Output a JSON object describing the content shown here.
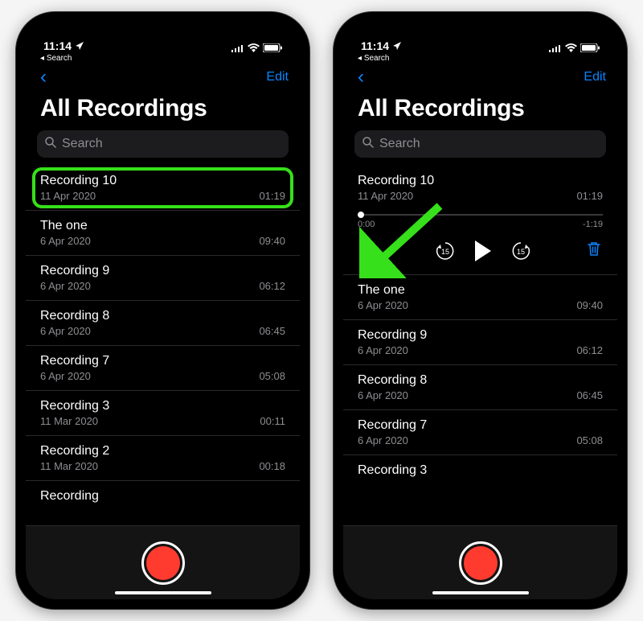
{
  "status": {
    "time": "11:14",
    "back_label": "Search"
  },
  "nav": {
    "edit": "Edit"
  },
  "title": "All Recordings",
  "search": {
    "placeholder": "Search"
  },
  "player": {
    "elapsed": "0:00",
    "remaining": "-1:19",
    "skip_seconds": "15"
  },
  "phone1_rows": [
    {
      "name": "Recording 10",
      "date": "11 Apr 2020",
      "dur": "01:19"
    },
    {
      "name": "The one",
      "date": "6 Apr 2020",
      "dur": "09:40"
    },
    {
      "name": "Recording 9",
      "date": "6 Apr 2020",
      "dur": "06:12"
    },
    {
      "name": "Recording 8",
      "date": "6 Apr 2020",
      "dur": "06:45"
    },
    {
      "name": "Recording 7",
      "date": "6 Apr 2020",
      "dur": "05:08"
    },
    {
      "name": "Recording 3",
      "date": "11 Mar 2020",
      "dur": "00:11"
    },
    {
      "name": "Recording 2",
      "date": "11 Mar 2020",
      "dur": "00:18"
    },
    {
      "name": "Recording",
      "date": "",
      "dur": ""
    }
  ],
  "phone2_rows": [
    {
      "name": "Recording 10",
      "date": "11 Apr 2020",
      "dur": "01:19"
    },
    {
      "name": "The one",
      "date": "6 Apr 2020",
      "dur": "09:40"
    },
    {
      "name": "Recording 9",
      "date": "6 Apr 2020",
      "dur": "06:12"
    },
    {
      "name": "Recording 8",
      "date": "6 Apr 2020",
      "dur": "06:45"
    },
    {
      "name": "Recording 7",
      "date": "6 Apr 2020",
      "dur": "05:08"
    },
    {
      "name": "Recording 3",
      "date": "",
      "dur": ""
    }
  ]
}
